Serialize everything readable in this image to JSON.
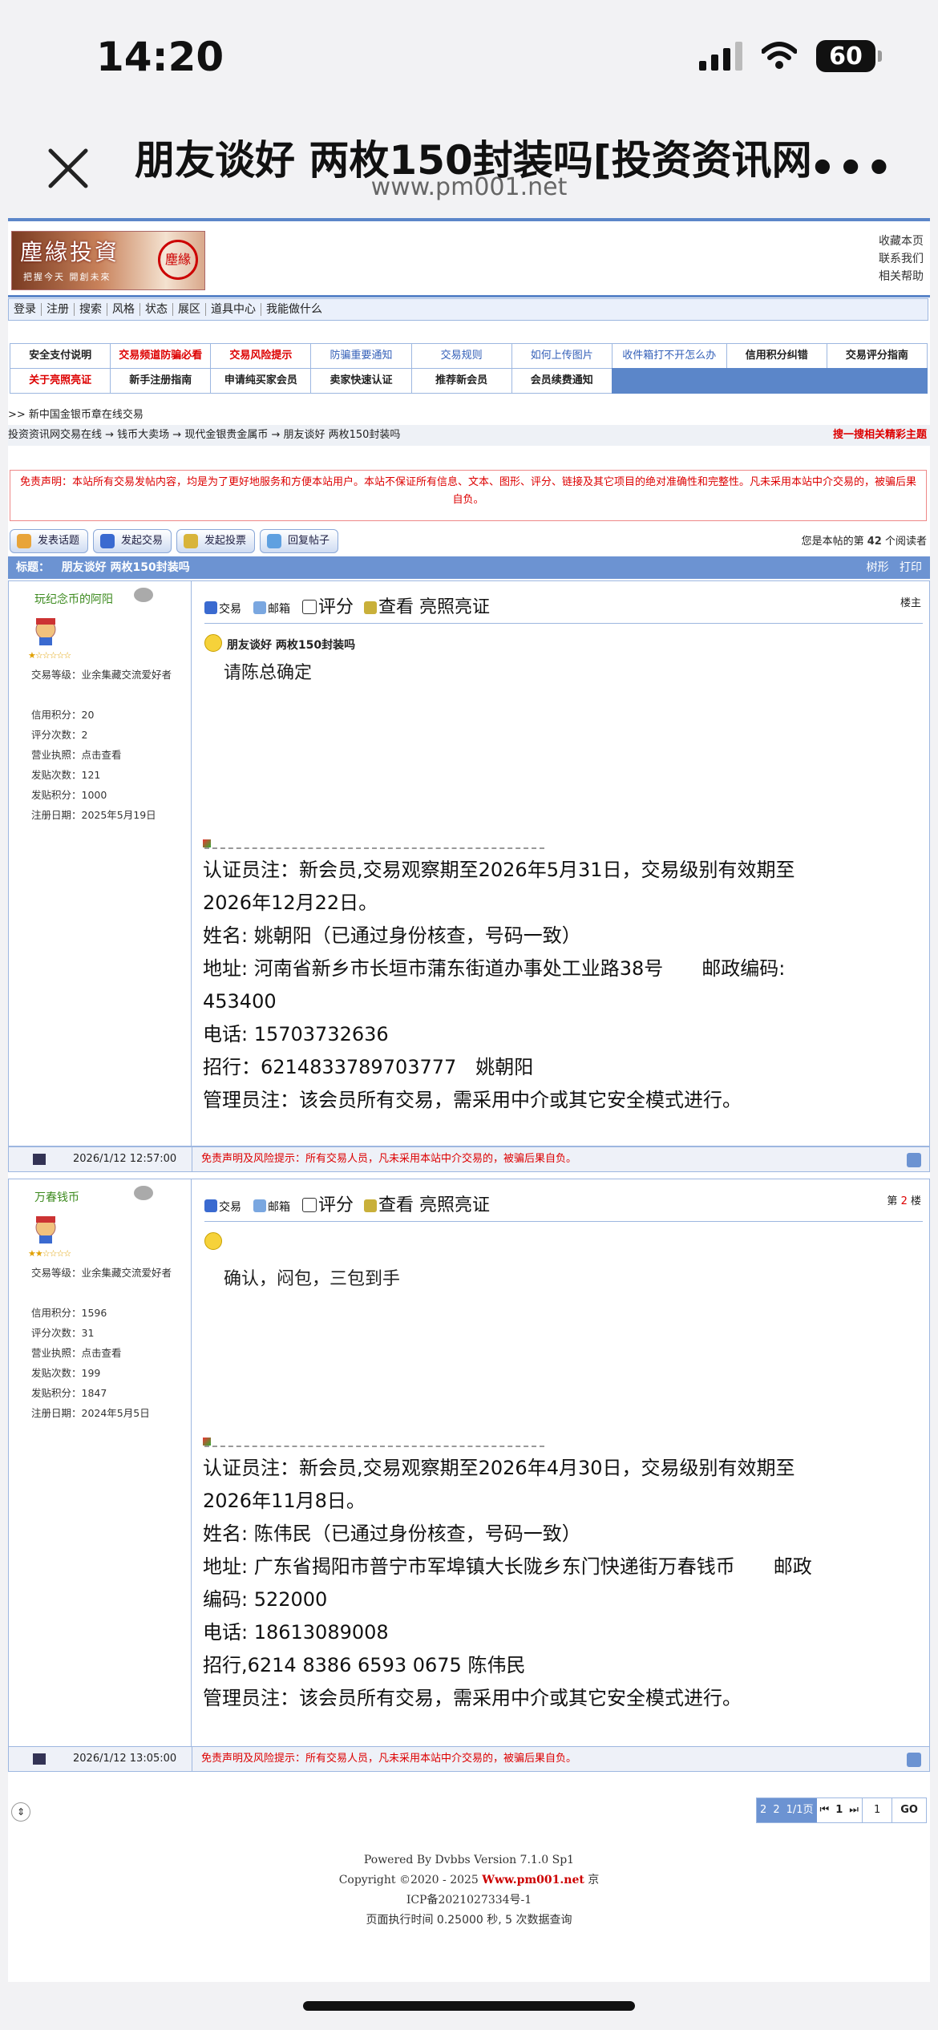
{
  "status": {
    "time": "14:20",
    "battery": "60"
  },
  "browser": {
    "title": "朋友谈好 两枚150封装吗[投资资讯网",
    "url": "www.pm001.net"
  },
  "logo": {
    "text": "塵緣投資",
    "slogan": "把握今天 開創未來",
    "seal": "塵緣"
  },
  "toplinks": [
    "收藏本页",
    "联系我们",
    "相关帮助"
  ],
  "menu": [
    "登录",
    "注册",
    "搜索",
    "风格",
    "状态",
    "展区",
    "道具中心",
    "我能做什么"
  ],
  "grid_row1": [
    {
      "t": "安全支付说明",
      "c": "black"
    },
    {
      "t": "交易频道防骗必看",
      "c": "red"
    },
    {
      "t": "交易风险提示",
      "c": "red"
    },
    {
      "t": "防骗重要通知",
      "c": "blue"
    },
    {
      "t": "交易规则",
      "c": "blue"
    },
    {
      "t": "如何上传图片",
      "c": "blue"
    },
    {
      "t": "收件箱打不开怎么办",
      "c": "blue"
    },
    {
      "t": "信用积分纠错",
      "c": "black"
    },
    {
      "t": "交易评分指南",
      "c": "black"
    }
  ],
  "grid_row2": [
    {
      "t": "关于亮照亮证",
      "c": "red"
    },
    {
      "t": "新手注册指南",
      "c": "black"
    },
    {
      "t": "申请纯买家会员",
      "c": "black"
    },
    {
      "t": "卖家快速认证",
      "c": "black"
    },
    {
      "t": "推荐新会员",
      "c": "black"
    },
    {
      "t": "会员续费通知",
      "c": "black"
    }
  ],
  "crumb1": ">> 新中国金银币章在线交易",
  "crumb2": "投资资讯网交易在线 → 钱币大卖场 → 现代金银贵金属币 → 朋友谈好 两枚150封装吗",
  "crumb_hot": "搜一搜相关精彩主题",
  "disclaimer": "免责声明：本站所有交易发帖内容，均是为了更好地服务和方便本站用户。本站不保证所有信息、文本、图形、评分、链接及其它项目的绝对准确性和完整性。凡未采用本站中介交易的，被骗后果自负。",
  "actions": [
    "发表话题",
    "发起交易",
    "发起投票",
    "回复帖子"
  ],
  "readers_prefix": "您是本帖的第",
  "readers_count": "42",
  "readers_suffix": "个阅读者",
  "thread": {
    "label": "标题：",
    "title": "朋友谈好 两枚150封装吗",
    "tree": "树形",
    "print": "打印"
  },
  "post_tools": {
    "trade": "交易",
    "mail": "邮箱",
    "score": "评分",
    "view": "查看 亮照亮证"
  },
  "posts": [
    {
      "user": "玩纪念币的阿阳",
      "level": "交易等级：业余集藏交流爱好者",
      "credit": "信用积分：20",
      "ratings": "评分次数：2",
      "license": "营业执照：点击查看",
      "posts": "发贴次数：121",
      "points": "发贴积分：1000",
      "reg": "注册日期：2025年5月19日",
      "floor_label": "楼主",
      "floor_num": "",
      "title": "朋友谈好 两枚150封装吗",
      "body": "请陈总确定",
      "sig": [
        "认证员注：新会员,交易观察期至2026年5月31日，交易级别有效期至",
        "2026年12月22日。",
        "姓名: 姚朝阳（已通过身份核查，号码一致）",
        "地址: 河南省新乡市长垣市蒲东街道办事处工业路38号　　邮政编码:",
        "453400",
        "电话: 15703732636",
        "招行：6214833789703777　姚朝阳",
        "管理员注：该会员所有交易，需采用中介或其它安全模式进行。"
      ],
      "date": "2026/1/12 12:57:00"
    },
    {
      "user": "万春钱币",
      "level": "交易等级：业余集藏交流爱好者",
      "credit": "信用积分：1596",
      "ratings": "评分次数：31",
      "license": "营业执照：点击查看",
      "posts": "发贴次数：199",
      "points": "发贴积分：1847",
      "reg": "注册日期：2024年5月5日",
      "floor_label": "第",
      "floor_num": "2",
      "floor_suffix": "楼",
      "title": "",
      "body": "确认，闷包，三包到手",
      "sig": [
        "认证员注：新会员,交易观察期至2026年4月30日，交易级别有效期至",
        "2026年11月8日。",
        "姓名: 陈伟民（已通过身份核查，号码一致）",
        "地址: 广东省揭阳市普宁市军埠镇大长陇乡东门快递街万春钱币　　邮政",
        "编码: 522000",
        "电话: 18613089008",
        "招行,6214 8386 6593 0675  陈伟民",
        "管理员注：该会员所有交易，需采用中介或其它安全模式进行。"
      ],
      "date": "2026/1/12 13:05:00"
    }
  ],
  "risk": "免责声明及风险提示：所有交易人员，凡未采用本站中介交易的，被骗后果自负。",
  "pager": {
    "a": "2",
    "b": "2",
    "c": "1/1页",
    "first": "⏮",
    "cur": "1",
    "last": "⏭",
    "input": "1",
    "go": "GO"
  },
  "footer": {
    "powered": "Powered By Dvbbs Version 7.1.0 Sp1",
    "copy_pre": "Copyright ©2020 - 2025 ",
    "brand": "Www.pm001.net",
    "copy_post": " 京",
    "icp": "ICP备2021027334号-1",
    "exec": "页面执行时间 0.25000 秒, 5 次数据查询"
  }
}
